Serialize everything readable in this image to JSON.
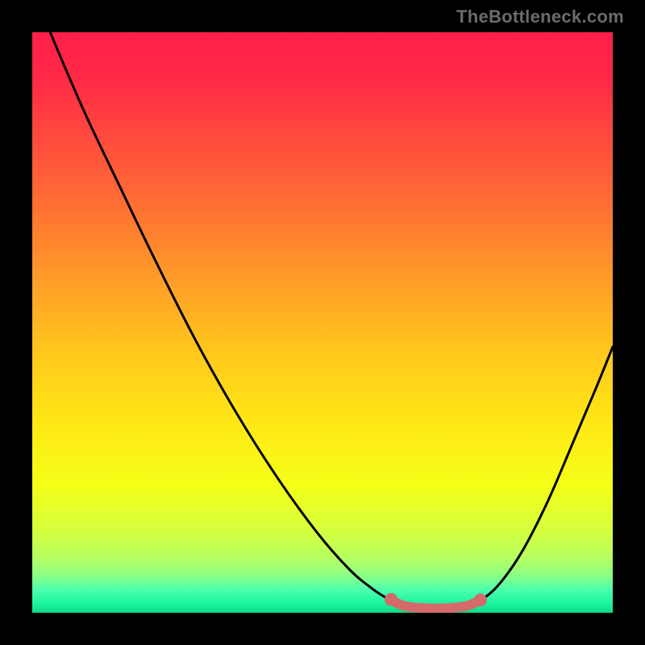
{
  "attribution": "TheBottleneck.com",
  "gradient_stops": [
    {
      "offset": 0.0,
      "color": "#ff1f4a"
    },
    {
      "offset": 0.08,
      "color": "#ff2946"
    },
    {
      "offset": 0.18,
      "color": "#ff4a3e"
    },
    {
      "offset": 0.3,
      "color": "#ff7033"
    },
    {
      "offset": 0.42,
      "color": "#ff9a29"
    },
    {
      "offset": 0.55,
      "color": "#ffc71d"
    },
    {
      "offset": 0.68,
      "color": "#ffe915"
    },
    {
      "offset": 0.78,
      "color": "#f4ff17"
    },
    {
      "offset": 0.86,
      "color": "#d4ff3e"
    },
    {
      "offset": 0.905,
      "color": "#b6ff60"
    },
    {
      "offset": 0.935,
      "color": "#8cff84"
    },
    {
      "offset": 0.96,
      "color": "#4dffae"
    },
    {
      "offset": 0.985,
      "color": "#18f59e"
    },
    {
      "offset": 1.0,
      "color": "#0fd883"
    }
  ],
  "chart_data": {
    "type": "line",
    "title": "",
    "xlabel": "",
    "ylabel": "",
    "xlim": [
      0,
      1
    ],
    "ylim": [
      0,
      1
    ],
    "series": [
      {
        "name": "bottleneck-curve",
        "color": "#000000",
        "stroke_width": 3,
        "points": [
          {
            "x": 0.031,
            "y": 1.0
          },
          {
            "x": 0.06,
            "y": 0.931
          },
          {
            "x": 0.097,
            "y": 0.847
          },
          {
            "x": 0.15,
            "y": 0.736
          },
          {
            "x": 0.21,
            "y": 0.611
          },
          {
            "x": 0.28,
            "y": 0.472
          },
          {
            "x": 0.35,
            "y": 0.347
          },
          {
            "x": 0.42,
            "y": 0.236
          },
          {
            "x": 0.49,
            "y": 0.139
          },
          {
            "x": 0.545,
            "y": 0.076
          },
          {
            "x": 0.585,
            "y": 0.042
          },
          {
            "x": 0.615,
            "y": 0.023
          },
          {
            "x": 0.644,
            "y": 0.012
          },
          {
            "x": 0.676,
            "y": 0.008
          },
          {
            "x": 0.715,
            "y": 0.008
          },
          {
            "x": 0.749,
            "y": 0.012
          },
          {
            "x": 0.778,
            "y": 0.025
          },
          {
            "x": 0.81,
            "y": 0.056
          },
          {
            "x": 0.847,
            "y": 0.111
          },
          {
            "x": 0.889,
            "y": 0.194
          },
          {
            "x": 0.931,
            "y": 0.292
          },
          {
            "x": 0.972,
            "y": 0.389
          },
          {
            "x": 1.0,
            "y": 0.458
          }
        ]
      },
      {
        "name": "highlight-band",
        "color": "#d46a6a",
        "stroke_width": 12,
        "linecap": "round",
        "points": [
          {
            "x": 0.618,
            "y": 0.023
          },
          {
            "x": 0.64,
            "y": 0.012
          },
          {
            "x": 0.676,
            "y": 0.008
          },
          {
            "x": 0.715,
            "y": 0.008
          },
          {
            "x": 0.749,
            "y": 0.012
          },
          {
            "x": 0.772,
            "y": 0.022
          }
        ]
      }
    ],
    "markers": [
      {
        "x": 0.618,
        "y": 0.023,
        "r": 8,
        "fill": "#d46a6a"
      },
      {
        "x": 0.772,
        "y": 0.022,
        "r": 8,
        "fill": "#d46a6a"
      }
    ]
  }
}
